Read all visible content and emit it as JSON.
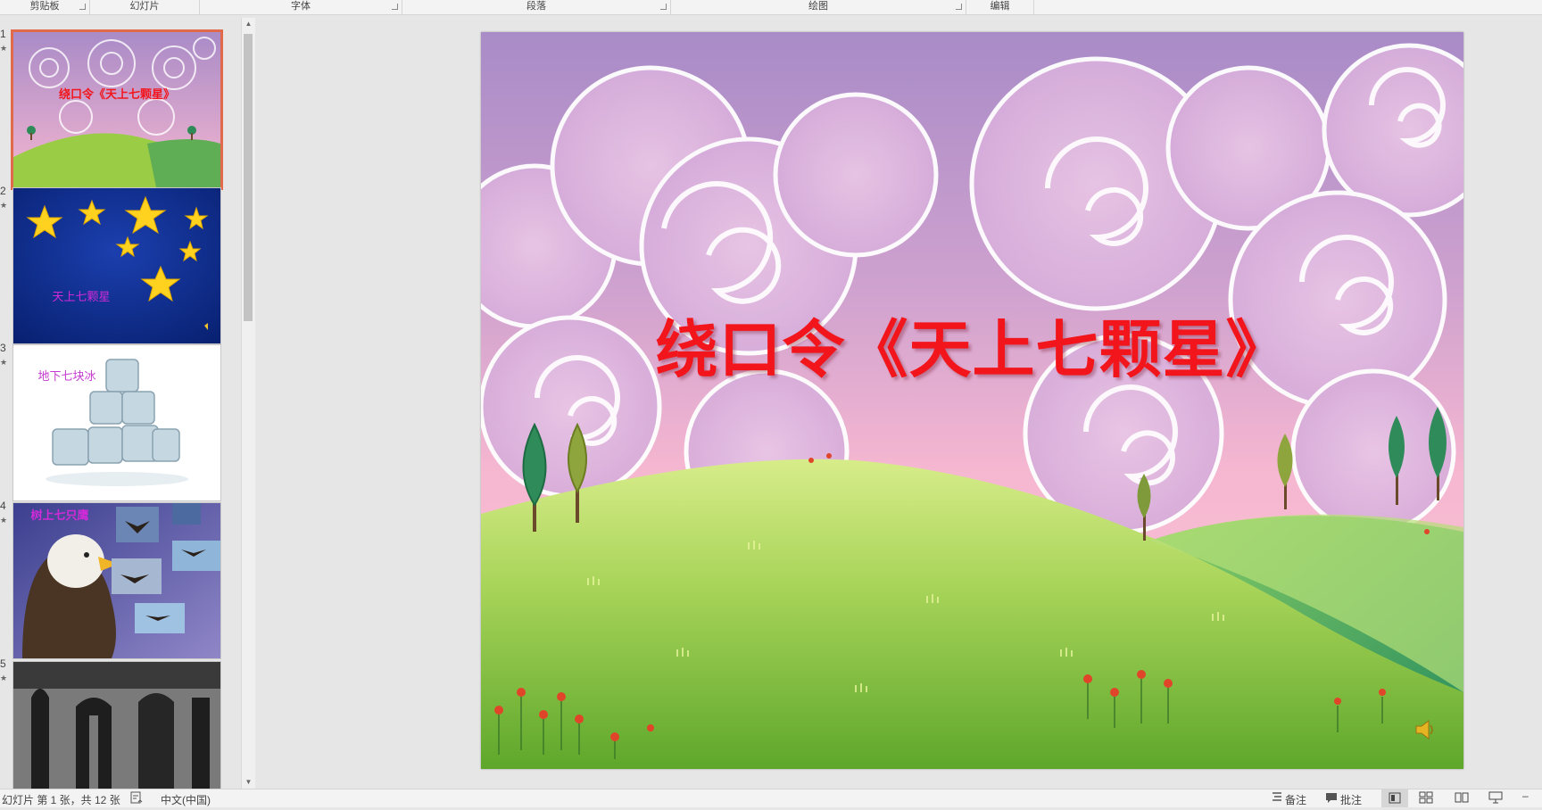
{
  "ribbon": {
    "groups": [
      "剪贴板",
      "幻灯片",
      "字体",
      "段落",
      "绘图",
      "编辑"
    ]
  },
  "thumbnails": [
    {
      "number": "1",
      "title": "绕口令《天上七颗星》",
      "selected": true
    },
    {
      "number": "2",
      "title": "天上七颗星"
    },
    {
      "number": "3",
      "title": "地下七块冰"
    },
    {
      "number": "4",
      "title": "树上七只鹰"
    },
    {
      "number": "5",
      "title": ""
    }
  ],
  "slide": {
    "title": "绕口令《天上七颗星》"
  },
  "statusbar": {
    "slide_info": "幻灯片 第 1 张，共 12 张",
    "language": "中文(中国)",
    "notes": "备注",
    "comments": "批注"
  },
  "colors": {
    "title_red": "#f2161c",
    "selection_orange": "#e06a4a",
    "sky_purple": "#a98bc7",
    "sky_pink": "#f6b7d0",
    "hill_green": "#9acd45",
    "night_blue": "#0a2a8a",
    "star_yellow": "#ffd21f"
  }
}
